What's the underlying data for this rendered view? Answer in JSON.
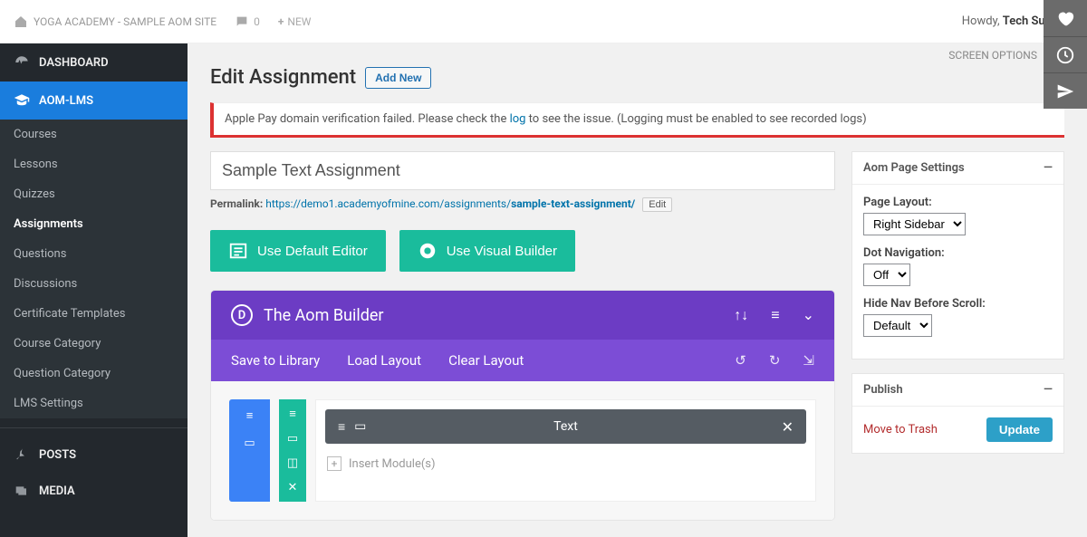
{
  "adminbar": {
    "site_name": "YOGA ACADEMY - SAMPLE AOM SITE",
    "comment_count": "0",
    "new_label": "NEW",
    "howdy_prefix": "Howdy, ",
    "howdy_user": "Tech Support"
  },
  "screen_options": "SCREEN OPTIONS",
  "sidebar": {
    "dashboard": "DASHBOARD",
    "aom_lms": "AOM-LMS",
    "submenu": [
      "Courses",
      "Lessons",
      "Quizzes",
      "Assignments",
      "Questions",
      "Discussions",
      "Certificate Templates",
      "Course Category",
      "Question Category",
      "LMS Settings"
    ],
    "posts": "POSTS",
    "media": "MEDIA"
  },
  "page": {
    "title": "Edit Assignment",
    "add_new": "Add New",
    "notice_pre": "Apple Pay domain verification failed. Please check the ",
    "notice_link": "log",
    "notice_post": " to see the issue. (Logging must be enabled to see recorded logs)",
    "post_title": "Sample Text Assignment",
    "permalink_label": "Permalink: ",
    "permalink_url_pre": "https://demo1.academyofmine.com/assignments/",
    "permalink_slug": "sample-text-assignment/",
    "permalink_edit": "Edit",
    "btn_default_editor": "Use Default Editor",
    "btn_visual_builder": "Use Visual Builder"
  },
  "builder": {
    "title": "The Aom Builder",
    "save_library": "Save to Library",
    "load_layout": "Load Layout",
    "clear_layout": "Clear Layout",
    "module_title": "Text",
    "insert_module": "Insert Module(s)"
  },
  "meta": {
    "page_settings_title": "Aom Page Settings",
    "page_layout_label": "Page Layout:",
    "page_layout_value": "Right Sidebar",
    "dot_nav_label": "Dot Navigation:",
    "dot_nav_value": "Off",
    "hide_nav_label": "Hide Nav Before Scroll:",
    "hide_nav_value": "Default",
    "publish_title": "Publish",
    "trash": "Move to Trash",
    "update": "Update"
  }
}
